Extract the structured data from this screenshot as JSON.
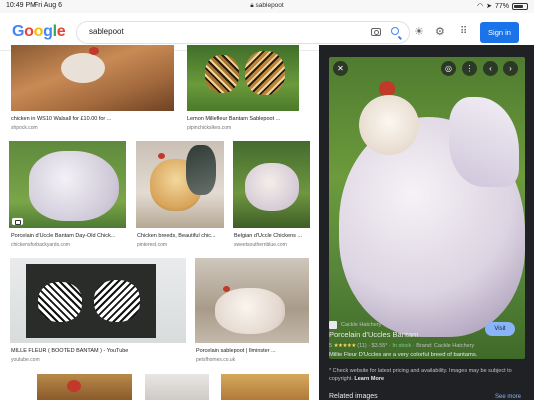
{
  "status_bar": {
    "time": "10:49 PM",
    "date": "Fri Aug 6",
    "url": "sablepoot",
    "battery": "77%",
    "battery_level": 0.77
  },
  "header": {
    "logo_letters": [
      "G",
      "o",
      "o",
      "g",
      "l",
      "e"
    ],
    "query": "sablepoot",
    "sign_in": "Sign in"
  },
  "results": [
    {
      "caption": "chicken in WS10 Walsall for £10.00 for ...",
      "source": "shpock.com"
    },
    {
      "caption": "Lemon Millefleur Bantam Sablepoot ...",
      "source": "pipinchickslkes.com"
    },
    {
      "caption": "Porcelain d'Uccle Bantam Day-Old Chick...",
      "source": "chickensforbackyards.com"
    },
    {
      "caption": "Chicken breeds, Beautiful chic...",
      "source": "pinterest.com"
    },
    {
      "caption": "Belgian d'Uccle Chickens ...",
      "source": "sweetsouthernblue.com"
    },
    {
      "caption": "MILLE FLEUR ( BOOTED BANTAM ) - YouTube",
      "source": "youtube.com"
    },
    {
      "caption": "Porcelain sablepoot | Ilminster ...",
      "source": "petsfhomes.co.uk"
    }
  ],
  "panel": {
    "seller": "Cackle Hatchery",
    "title": "Porcelain d'Uccles Bantam",
    "visit": "Visit",
    "rating_value": "5",
    "stars": "★★★★★",
    "reviews": "(11)",
    "price": "$3.55*",
    "stock": "In stock",
    "brand": "Brand: Cackle Hatchery",
    "description": "Millie Fleur D'Uccles are a very colorful breed of bantams.",
    "note": "* Check website for latest pricing and availability. Images may be subject to copyright.",
    "learn_more": "Learn More",
    "related": "Related images",
    "see_more": "See more"
  },
  "colors": {
    "brand_blue": "#1a73e8",
    "panel_bg": "#202124",
    "star": "#fdd663",
    "in_stock": "#81c995"
  }
}
